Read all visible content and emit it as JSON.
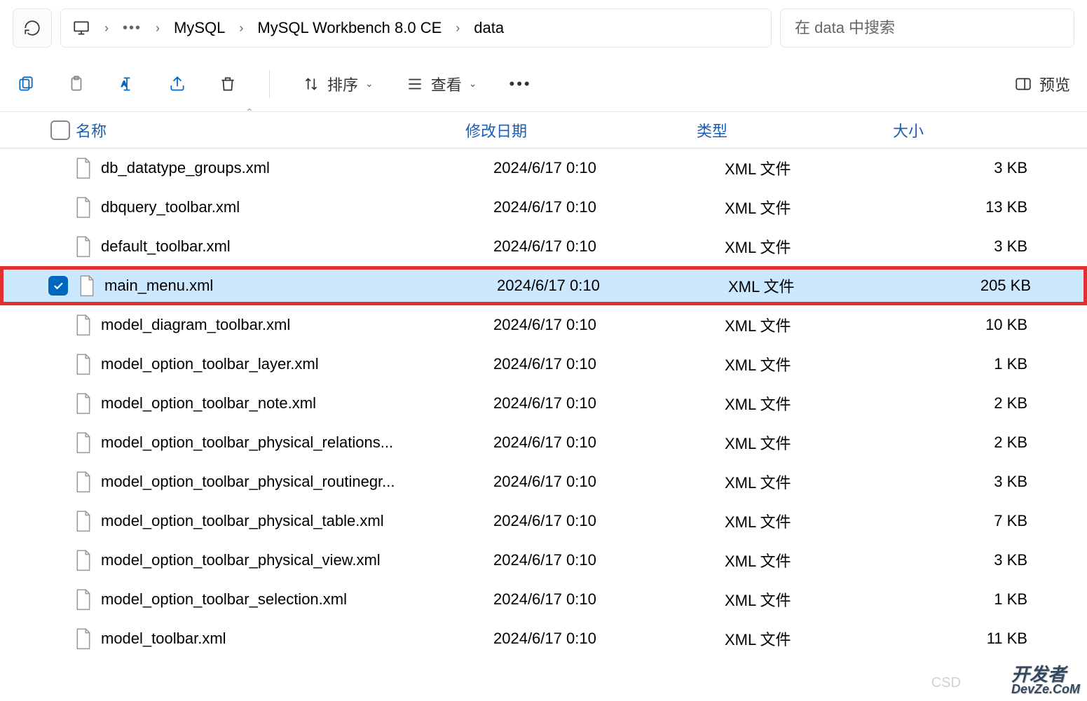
{
  "breadcrumb": {
    "items": [
      "MySQL",
      "MySQL Workbench 8.0 CE",
      "data"
    ]
  },
  "search": {
    "placeholder": "在 data 中搜索"
  },
  "toolbar": {
    "sort_label": "排序",
    "view_label": "查看",
    "preview_label": "预览"
  },
  "columns": {
    "name": "名称",
    "date": "修改日期",
    "type": "类型",
    "size": "大小"
  },
  "files": [
    {
      "name": "db_datatype_groups.xml",
      "date": "2024/6/17 0:10",
      "type": "XML 文件",
      "size": "3 KB",
      "selected": false,
      "highlighted": false
    },
    {
      "name": "dbquery_toolbar.xml",
      "date": "2024/6/17 0:10",
      "type": "XML 文件",
      "size": "13 KB",
      "selected": false,
      "highlighted": false
    },
    {
      "name": "default_toolbar.xml",
      "date": "2024/6/17 0:10",
      "type": "XML 文件",
      "size": "3 KB",
      "selected": false,
      "highlighted": false
    },
    {
      "name": "main_menu.xml",
      "date": "2024/6/17 0:10",
      "type": "XML 文件",
      "size": "205 KB",
      "selected": true,
      "highlighted": true
    },
    {
      "name": "model_diagram_toolbar.xml",
      "date": "2024/6/17 0:10",
      "type": "XML 文件",
      "size": "10 KB",
      "selected": false,
      "highlighted": false
    },
    {
      "name": "model_option_toolbar_layer.xml",
      "date": "2024/6/17 0:10",
      "type": "XML 文件",
      "size": "1 KB",
      "selected": false,
      "highlighted": false
    },
    {
      "name": "model_option_toolbar_note.xml",
      "date": "2024/6/17 0:10",
      "type": "XML 文件",
      "size": "2 KB",
      "selected": false,
      "highlighted": false
    },
    {
      "name": "model_option_toolbar_physical_relations...",
      "date": "2024/6/17 0:10",
      "type": "XML 文件",
      "size": "2 KB",
      "selected": false,
      "highlighted": false
    },
    {
      "name": "model_option_toolbar_physical_routinegr...",
      "date": "2024/6/17 0:10",
      "type": "XML 文件",
      "size": "3 KB",
      "selected": false,
      "highlighted": false
    },
    {
      "name": "model_option_toolbar_physical_table.xml",
      "date": "2024/6/17 0:10",
      "type": "XML 文件",
      "size": "7 KB",
      "selected": false,
      "highlighted": false
    },
    {
      "name": "model_option_toolbar_physical_view.xml",
      "date": "2024/6/17 0:10",
      "type": "XML 文件",
      "size": "3 KB",
      "selected": false,
      "highlighted": false
    },
    {
      "name": "model_option_toolbar_selection.xml",
      "date": "2024/6/17 0:10",
      "type": "XML 文件",
      "size": "1 KB",
      "selected": false,
      "highlighted": false
    },
    {
      "name": "model_toolbar.xml",
      "date": "2024/6/17 0:10",
      "type": "XML 文件",
      "size": "11 KB",
      "selected": false,
      "highlighted": false
    }
  ],
  "watermark": {
    "main": "开发者",
    "sub": "DevZe.CoM",
    "csd": "CSD"
  }
}
